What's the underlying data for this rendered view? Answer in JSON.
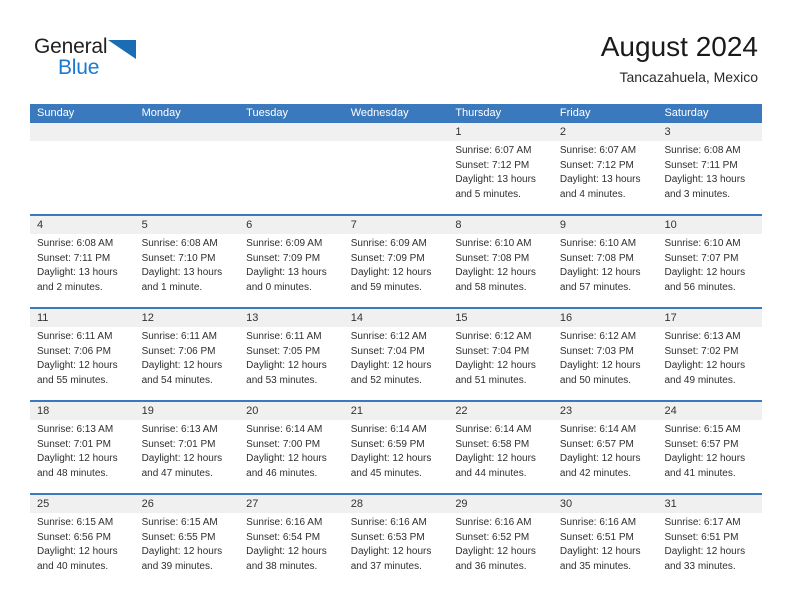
{
  "brand": {
    "name_top": "General",
    "name_bottom": "Blue",
    "triangle_color": "#1a6cb5",
    "text_color": "#231f20",
    "blue_color": "#1a7ad1"
  },
  "header": {
    "title": "August 2024",
    "subtitle": "Tancazahuela, Mexico"
  },
  "theme": {
    "header_row_bg": "#3a79bd",
    "date_band_bg": "#f0f0f0",
    "week_divider": "#3a79bd",
    "page_bg": "#ffffff"
  },
  "calendar": {
    "weekdays": [
      "Sunday",
      "Monday",
      "Tuesday",
      "Wednesday",
      "Thursday",
      "Friday",
      "Saturday"
    ],
    "weeks": [
      [
        {
          "day": "",
          "empty": true
        },
        {
          "day": "",
          "empty": true
        },
        {
          "day": "",
          "empty": true
        },
        {
          "day": "",
          "empty": true
        },
        {
          "day": "1",
          "sunrise": "Sunrise: 6:07 AM",
          "sunset": "Sunset: 7:12 PM",
          "daylight_1": "Daylight: 13 hours",
          "daylight_2": "and 5 minutes."
        },
        {
          "day": "2",
          "sunrise": "Sunrise: 6:07 AM",
          "sunset": "Sunset: 7:12 PM",
          "daylight_1": "Daylight: 13 hours",
          "daylight_2": "and 4 minutes."
        },
        {
          "day": "3",
          "sunrise": "Sunrise: 6:08 AM",
          "sunset": "Sunset: 7:11 PM",
          "daylight_1": "Daylight: 13 hours",
          "daylight_2": "and 3 minutes."
        }
      ],
      [
        {
          "day": "4",
          "sunrise": "Sunrise: 6:08 AM",
          "sunset": "Sunset: 7:11 PM",
          "daylight_1": "Daylight: 13 hours",
          "daylight_2": "and 2 minutes."
        },
        {
          "day": "5",
          "sunrise": "Sunrise: 6:08 AM",
          "sunset": "Sunset: 7:10 PM",
          "daylight_1": "Daylight: 13 hours",
          "daylight_2": "and 1 minute."
        },
        {
          "day": "6",
          "sunrise": "Sunrise: 6:09 AM",
          "sunset": "Sunset: 7:09 PM",
          "daylight_1": "Daylight: 13 hours",
          "daylight_2": "and 0 minutes."
        },
        {
          "day": "7",
          "sunrise": "Sunrise: 6:09 AM",
          "sunset": "Sunset: 7:09 PM",
          "daylight_1": "Daylight: 12 hours",
          "daylight_2": "and 59 minutes."
        },
        {
          "day": "8",
          "sunrise": "Sunrise: 6:10 AM",
          "sunset": "Sunset: 7:08 PM",
          "daylight_1": "Daylight: 12 hours",
          "daylight_2": "and 58 minutes."
        },
        {
          "day": "9",
          "sunrise": "Sunrise: 6:10 AM",
          "sunset": "Sunset: 7:08 PM",
          "daylight_1": "Daylight: 12 hours",
          "daylight_2": "and 57 minutes."
        },
        {
          "day": "10",
          "sunrise": "Sunrise: 6:10 AM",
          "sunset": "Sunset: 7:07 PM",
          "daylight_1": "Daylight: 12 hours",
          "daylight_2": "and 56 minutes."
        }
      ],
      [
        {
          "day": "11",
          "sunrise": "Sunrise: 6:11 AM",
          "sunset": "Sunset: 7:06 PM",
          "daylight_1": "Daylight: 12 hours",
          "daylight_2": "and 55 minutes."
        },
        {
          "day": "12",
          "sunrise": "Sunrise: 6:11 AM",
          "sunset": "Sunset: 7:06 PM",
          "daylight_1": "Daylight: 12 hours",
          "daylight_2": "and 54 minutes."
        },
        {
          "day": "13",
          "sunrise": "Sunrise: 6:11 AM",
          "sunset": "Sunset: 7:05 PM",
          "daylight_1": "Daylight: 12 hours",
          "daylight_2": "and 53 minutes."
        },
        {
          "day": "14",
          "sunrise": "Sunrise: 6:12 AM",
          "sunset": "Sunset: 7:04 PM",
          "daylight_1": "Daylight: 12 hours",
          "daylight_2": "and 52 minutes."
        },
        {
          "day": "15",
          "sunrise": "Sunrise: 6:12 AM",
          "sunset": "Sunset: 7:04 PM",
          "daylight_1": "Daylight: 12 hours",
          "daylight_2": "and 51 minutes."
        },
        {
          "day": "16",
          "sunrise": "Sunrise: 6:12 AM",
          "sunset": "Sunset: 7:03 PM",
          "daylight_1": "Daylight: 12 hours",
          "daylight_2": "and 50 minutes."
        },
        {
          "day": "17",
          "sunrise": "Sunrise: 6:13 AM",
          "sunset": "Sunset: 7:02 PM",
          "daylight_1": "Daylight: 12 hours",
          "daylight_2": "and 49 minutes."
        }
      ],
      [
        {
          "day": "18",
          "sunrise": "Sunrise: 6:13 AM",
          "sunset": "Sunset: 7:01 PM",
          "daylight_1": "Daylight: 12 hours",
          "daylight_2": "and 48 minutes."
        },
        {
          "day": "19",
          "sunrise": "Sunrise: 6:13 AM",
          "sunset": "Sunset: 7:01 PM",
          "daylight_1": "Daylight: 12 hours",
          "daylight_2": "and 47 minutes."
        },
        {
          "day": "20",
          "sunrise": "Sunrise: 6:14 AM",
          "sunset": "Sunset: 7:00 PM",
          "daylight_1": "Daylight: 12 hours",
          "daylight_2": "and 46 minutes."
        },
        {
          "day": "21",
          "sunrise": "Sunrise: 6:14 AM",
          "sunset": "Sunset: 6:59 PM",
          "daylight_1": "Daylight: 12 hours",
          "daylight_2": "and 45 minutes."
        },
        {
          "day": "22",
          "sunrise": "Sunrise: 6:14 AM",
          "sunset": "Sunset: 6:58 PM",
          "daylight_1": "Daylight: 12 hours",
          "daylight_2": "and 44 minutes."
        },
        {
          "day": "23",
          "sunrise": "Sunrise: 6:14 AM",
          "sunset": "Sunset: 6:57 PM",
          "daylight_1": "Daylight: 12 hours",
          "daylight_2": "and 42 minutes."
        },
        {
          "day": "24",
          "sunrise": "Sunrise: 6:15 AM",
          "sunset": "Sunset: 6:57 PM",
          "daylight_1": "Daylight: 12 hours",
          "daylight_2": "and 41 minutes."
        }
      ],
      [
        {
          "day": "25",
          "sunrise": "Sunrise: 6:15 AM",
          "sunset": "Sunset: 6:56 PM",
          "daylight_1": "Daylight: 12 hours",
          "daylight_2": "and 40 minutes."
        },
        {
          "day": "26",
          "sunrise": "Sunrise: 6:15 AM",
          "sunset": "Sunset: 6:55 PM",
          "daylight_1": "Daylight: 12 hours",
          "daylight_2": "and 39 minutes."
        },
        {
          "day": "27",
          "sunrise": "Sunrise: 6:16 AM",
          "sunset": "Sunset: 6:54 PM",
          "daylight_1": "Daylight: 12 hours",
          "daylight_2": "and 38 minutes."
        },
        {
          "day": "28",
          "sunrise": "Sunrise: 6:16 AM",
          "sunset": "Sunset: 6:53 PM",
          "daylight_1": "Daylight: 12 hours",
          "daylight_2": "and 37 minutes."
        },
        {
          "day": "29",
          "sunrise": "Sunrise: 6:16 AM",
          "sunset": "Sunset: 6:52 PM",
          "daylight_1": "Daylight: 12 hours",
          "daylight_2": "and 36 minutes."
        },
        {
          "day": "30",
          "sunrise": "Sunrise: 6:16 AM",
          "sunset": "Sunset: 6:51 PM",
          "daylight_1": "Daylight: 12 hours",
          "daylight_2": "and 35 minutes."
        },
        {
          "day": "31",
          "sunrise": "Sunrise: 6:17 AM",
          "sunset": "Sunset: 6:51 PM",
          "daylight_1": "Daylight: 12 hours",
          "daylight_2": "and 33 minutes."
        }
      ]
    ]
  }
}
